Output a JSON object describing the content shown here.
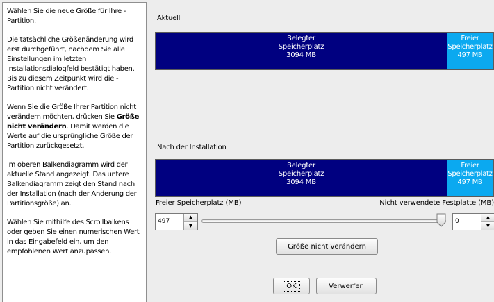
{
  "help": {
    "p1": "Wählen Sie die neue Größe für Ihre -Partition.",
    "p2": "Die tatsächliche Größenänderung wird erst durchgeführt, nachdem Sie alle Einstellungen im letzten Installationsdialogfeld bestätigt haben. Bis zu diesem Zeitpunkt wird die - Partition nicht verändert.",
    "p3_before": "Wenn Sie die Größe Ihrer Partition nicht verändern möchten, drücken Sie ",
    "p3_bold": "Größe nicht verändern",
    "p3_after": ". Damit werden die Werte auf die ursprüngliche Größe der Partition zurückgesetzt.",
    "p4": "Im oberen Balkendiagramm wird der aktuelle Stand angezeigt. Das untere Balkendiagramm zeigt den Stand nach der Installation (nach der Änderung der Partitionsgröße) an.",
    "p5": "Wählen Sie mithilfe des Scrollbalkens oder geben Sie einen numerischen Wert in das Eingabefeld ein, um den empfohlenen Wert anzupassen."
  },
  "current": {
    "label": "Aktuell",
    "used_line1": "Belegter",
    "used_line2": "Speicherplatz",
    "used_value": "3094 MB",
    "free_line1": "Freier",
    "free_line2": "Speicherplatz",
    "free_value": "497 MB",
    "used_fraction": 0.862
  },
  "after": {
    "label": "Nach der Installation",
    "used_line1": "Belegter",
    "used_line2": "Speicherplatz",
    "used_value": "3094 MB",
    "free_line1": "Freier",
    "free_line2": "Speicherplatz",
    "free_value": "497 MB",
    "used_fraction": 0.862
  },
  "controls": {
    "free_space_caption": "Freier Speicherplatz (MB)",
    "unused_disk_caption": "Nicht verwendete Festplatte (MB)",
    "free_space_value": "497",
    "unused_disk_value": "0",
    "slider_position": 1.0
  },
  "buttons": {
    "keep_size": "Größe nicht verändern",
    "ok": "OK",
    "cancel": "Verwerfen"
  },
  "colors": {
    "used": "#000080",
    "free": "#0ba9f0"
  }
}
